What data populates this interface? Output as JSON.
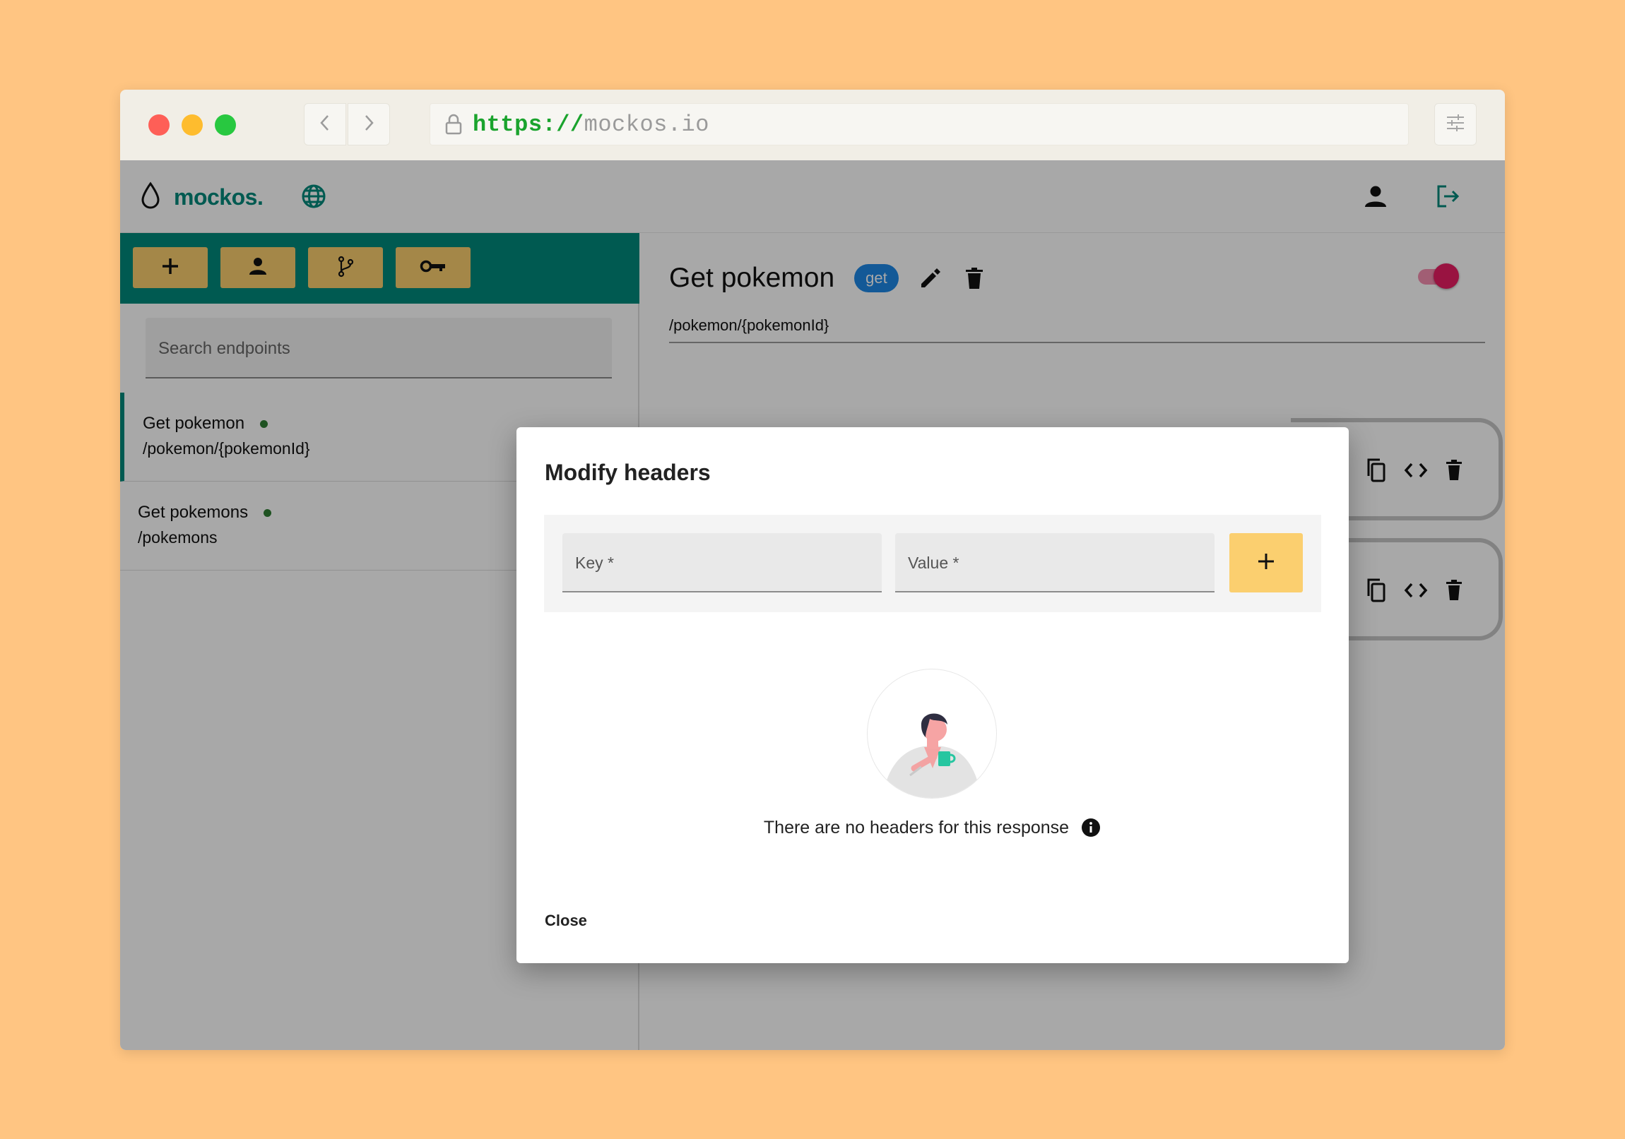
{
  "browser": {
    "url_scheme": "https://",
    "url_host": "mockos.io"
  },
  "app": {
    "brand": "mockos."
  },
  "sidebar": {
    "search_placeholder": "Search endpoints",
    "endpoints": [
      {
        "name": "Get pokemon",
        "path": "/pokemon/{pokemonId}"
      },
      {
        "name": "Get pokemons",
        "path": "/pokemons"
      }
    ]
  },
  "main": {
    "title": "Get pokemon",
    "method": "get",
    "route": "/pokemon/{pokemonId}",
    "enabled": true
  },
  "dialog": {
    "title": "Modify headers",
    "key_label": "Key *",
    "value_label": "Value *",
    "empty_message": "There are no headers for this response",
    "close_label": "Close"
  },
  "colors": {
    "primary": "#00897b",
    "accent_button": "#fbcf6f",
    "method_chip": "#1e88e5",
    "toggle": "#e91e63",
    "page_background": "#ffc582"
  }
}
